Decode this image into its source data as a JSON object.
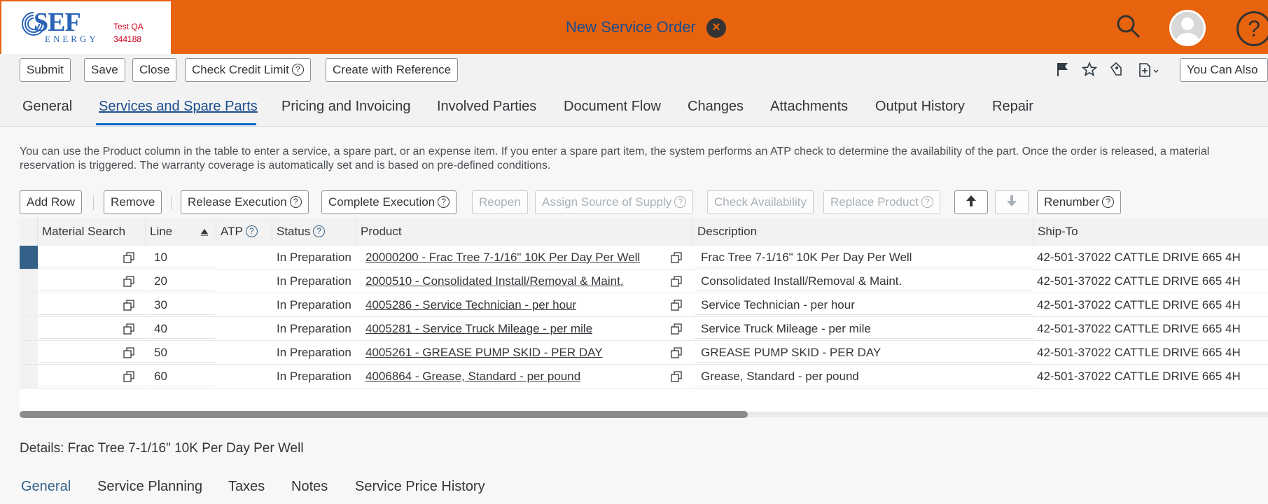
{
  "shell": {
    "logo_text": "SEF",
    "logo_subtext": "ENERGY",
    "environment": "Test QA",
    "environment_id": "344188",
    "title": "New Service Order"
  },
  "toolbar": {
    "submit": "Submit",
    "save": "Save",
    "close": "Close",
    "check_credit_limit": "Check Credit Limit",
    "create_with_reference": "Create with Reference",
    "you_can_also": "You Can Also"
  },
  "tabs": [
    {
      "label": "General"
    },
    {
      "label": "Services and Spare Parts"
    },
    {
      "label": "Pricing and Invoicing"
    },
    {
      "label": "Involved Parties"
    },
    {
      "label": "Document Flow"
    },
    {
      "label": "Changes"
    },
    {
      "label": "Attachments"
    },
    {
      "label": "Output History"
    },
    {
      "label": "Repair"
    }
  ],
  "active_tab": "Services and Spare Parts",
  "info_text": "You can use the Product column in the table to enter a service, a spare part, or an expense item. If you enter a spare part item, the system performs an ATP check to determine the availability of the part. Once the order is released, a material reservation is triggered. The warranty coverage is automatically set and is based on pre-defined conditions.",
  "table_toolbar": {
    "add_row": "Add Row",
    "remove": "Remove",
    "release_execution": "Release Execution",
    "complete_execution": "Complete Execution",
    "reopen": "Reopen",
    "assign_source": "Assign Source of Supply",
    "check_availability": "Check Availability",
    "replace_product": "Replace Product",
    "renumber": "Renumber"
  },
  "columns": {
    "material_search": "Material Search",
    "line": "Line",
    "atp": "ATP",
    "status": "Status",
    "product": "Product",
    "description": "Description",
    "ship_to": "Ship-To"
  },
  "rows": [
    {
      "line": "10",
      "status": "In Preparation",
      "product": "20000200 - Frac Tree 7-1/16\" 10K Per Day Per Well",
      "description": "Frac Tree 7-1/16\" 10K Per Day Per Well",
      "ship_to": "42-501-37022 CATTLE DRIVE 665 4H"
    },
    {
      "line": "20",
      "status": "In Preparation",
      "product": "2000510 - Consolidated Install/Removal & Maint.",
      "description": "Consolidated Install/Removal & Maint.",
      "ship_to": "42-501-37022 CATTLE DRIVE 665 4H"
    },
    {
      "line": "30",
      "status": "In Preparation",
      "product": "4005286 - Service Technician - per hour",
      "description": "Service Technician - per hour",
      "ship_to": "42-501-37022 CATTLE DRIVE 665 4H"
    },
    {
      "line": "40",
      "status": "In Preparation",
      "product": "4005281 - Service Truck Mileage - per mile",
      "description": "Service Truck Mileage - per mile",
      "ship_to": "42-501-37022 CATTLE DRIVE 665 4H"
    },
    {
      "line": "50",
      "status": "In Preparation",
      "product": "4005261 - GREASE PUMP SKID - PER DAY",
      "description": "GREASE PUMP SKID - PER DAY",
      "ship_to": "42-501-37022 CATTLE DRIVE 665 4H"
    },
    {
      "line": "60",
      "status": "In Preparation",
      "product": "4006864 - Grease, Standard - per pound",
      "description": "Grease, Standard - per pound",
      "ship_to": "42-501-37022 CATTLE DRIVE 665 4H"
    }
  ],
  "details_title": "Details: Frac Tree 7-1/16\" 10K Per Day Per Well",
  "sub_tabs": [
    {
      "label": "General"
    },
    {
      "label": "Service Planning"
    },
    {
      "label": "Taxes"
    },
    {
      "label": "Notes"
    },
    {
      "label": "Service Price History"
    }
  ],
  "colors": {
    "shell_orange": "#e8630d",
    "brand_blue": "#2a63b6",
    "selected_row": "#346187",
    "active_tab": "#0a6ed1"
  }
}
